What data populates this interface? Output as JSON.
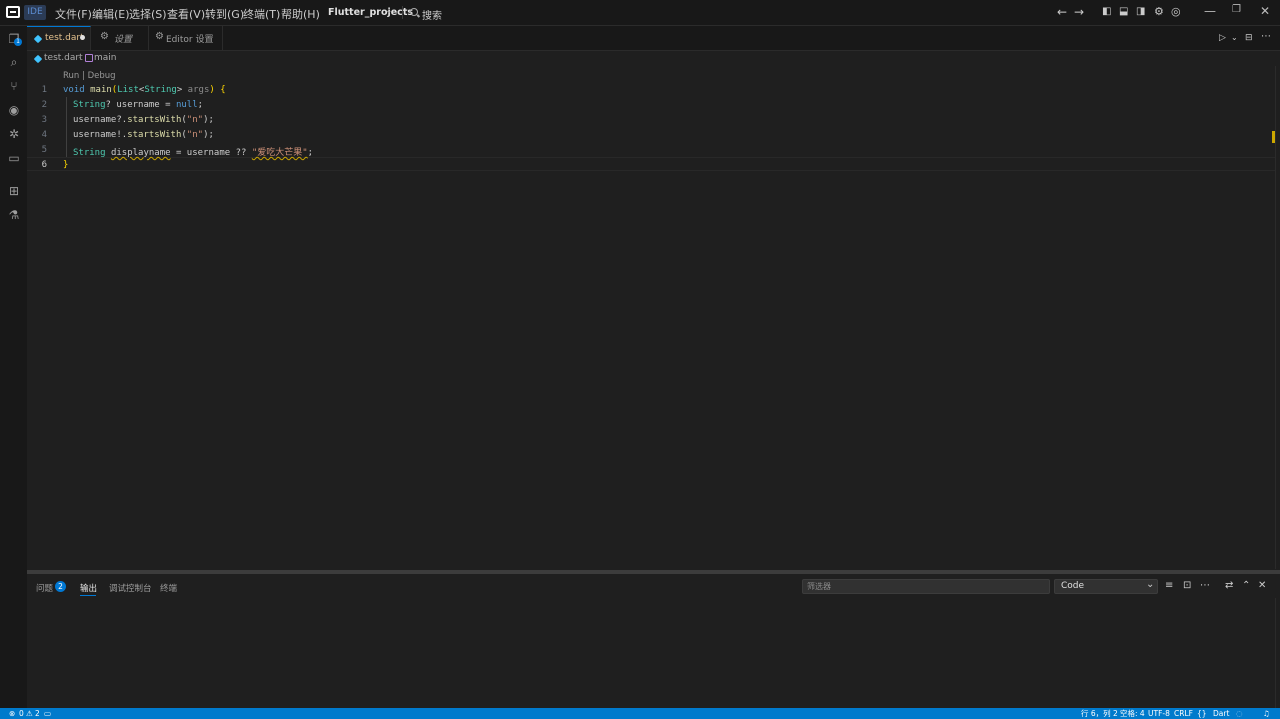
{
  "titlebar": {
    "badge": "IDE",
    "menus": [
      "文件(F)",
      "编辑(E)",
      "选择(S)",
      "查看(V)",
      "转到(G)",
      "终端(T)",
      "帮助(H)"
    ],
    "project": "Flutter_projects",
    "search_label": "搜索"
  },
  "activity": {
    "explorer_badge": "1"
  },
  "tabs": [
    {
      "label": "test.dart"
    },
    {
      "label": "设置"
    },
    {
      "label": "Editor 设置"
    }
  ],
  "breadcrumb": {
    "file": "test.dart",
    "symbol": "main"
  },
  "editor": {
    "codelens": "Run | Debug",
    "line_numbers": [
      "1",
      "2",
      "3",
      "4",
      "5",
      "6"
    ],
    "lines": {
      "l1": {
        "a": "void",
        "b": " ",
        "c": "main",
        "d": "(",
        "e": "List",
        "f": "<",
        "g": "String",
        "h": ">",
        "i": " args",
        "j": ")",
        "k": " {"
      },
      "l2": {
        "a": "String",
        "b": "? username = ",
        "c": "null",
        "d": ";"
      },
      "l3": {
        "a": "username?.",
        "b": "startsWith",
        "c": "(",
        "d": "\"n\"",
        "e": ");"
      },
      "l4": {
        "a": "username!.",
        "b": "startsWith",
        "c": "(",
        "d": "\"n\"",
        "e": ");"
      },
      "l5": {
        "a": "String",
        "b": " ",
        "c": "displayname",
        "d": " = username ?? ",
        "e": "\"爱吃大芒果\"",
        "f": ";"
      },
      "l6": {
        "a": "}"
      }
    }
  },
  "panel": {
    "tabs": {
      "problems": "问题",
      "output": "输出",
      "debug_console": "调试控制台",
      "terminal": "终端"
    },
    "problems_count": "2",
    "filter_placeholder": "筛选器",
    "output_channel": "Code"
  },
  "statusbar": {
    "errors": "0",
    "warnings": "2",
    "position": "行 6，列 2",
    "indent": "空格: 4",
    "encoding": "UTF-8",
    "eol": "CRLF",
    "language": "Dart"
  },
  "colors": {
    "accent": "#0078d4",
    "statusbar": "#007acc",
    "editor_bg": "#1f1f1f",
    "warning": "#cca700"
  }
}
